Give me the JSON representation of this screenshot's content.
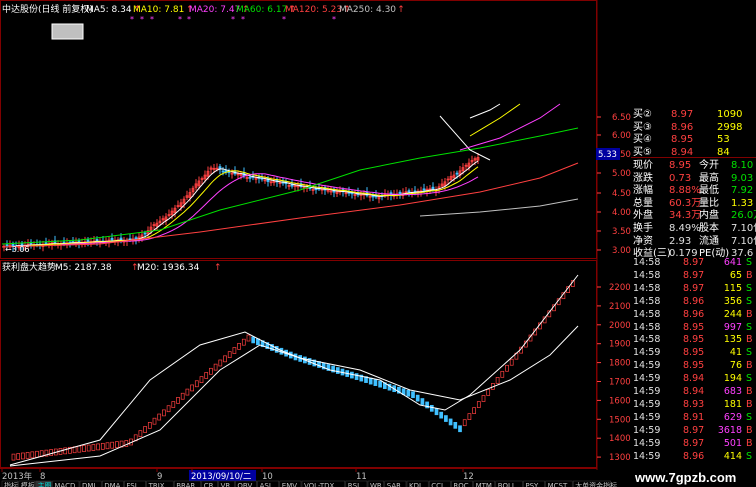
{
  "header": {
    "stock_name": "中达股份(日线 前复权)",
    "ma_items": [
      {
        "label": "MA5: 8.34",
        "color": "#ffffff"
      },
      {
        "label": "MA10: 7.81",
        "color": "#ffff00"
      },
      {
        "label": "MA20: 7.47",
        "color": "#ff40ff"
      },
      {
        "label": "MA60: 6.17",
        "color": "#00e000"
      },
      {
        "label": "MA120: 5.23",
        "color": "#ff4040"
      },
      {
        "label": "MA250: 4.30",
        "color": "#c0c0c0"
      }
    ]
  },
  "main_chart": {
    "price_axis": [
      "6.50",
      "6.00",
      "5.50",
      "5.00",
      "4.50",
      "4.00",
      "3.50",
      "3.00"
    ],
    "current_price_tag": "5.33",
    "low_annotation": "←3.06"
  },
  "sub_chart": {
    "title": "获利盘大趋势",
    "m5": "M5: 2187.38",
    "m20": "M20: 1936.34",
    "axis": [
      "2200",
      "2100",
      "2000",
      "1900",
      "1800",
      "1700",
      "1600",
      "1500",
      "1400",
      "1300"
    ]
  },
  "x_axis": {
    "labels": [
      "2013年",
      "8",
      "9",
      "2013/09/10/二",
      "10",
      "11",
      "12"
    ]
  },
  "bottom_tabs": [
    "指标",
    "模板",
    "主图",
    "MACD",
    "DMI",
    "DMA",
    "FSL",
    "TRIX",
    "BRAR",
    "CR",
    "VR",
    "OBV",
    "ASI",
    "EMV",
    "VOL-TDX",
    "RSI",
    "WR",
    "SAR",
    "KDJ",
    "CCI",
    "ROC",
    "MTM",
    "BOLL",
    "PSY",
    "MCST",
    "大单资金指标"
  ],
  "quote_panel": {
    "order_book": [
      {
        "label": "买②",
        "price": "8.97",
        "vol": "1090"
      },
      {
        "label": "买③",
        "price": "8.96",
        "vol": "2998"
      },
      {
        "label": "买④",
        "price": "8.95",
        "vol": "53"
      },
      {
        "label": "买⑤",
        "price": "8.94",
        "vol": "84"
      }
    ],
    "stats": [
      {
        "l1": "现价",
        "v1": "8.95",
        "l2": "今开",
        "v2": "8.10"
      },
      {
        "l1": "涨跌",
        "v1": "0.73",
        "l2": "最高",
        "v2": "9.03"
      },
      {
        "l1": "涨幅",
        "v1": "8.88%",
        "l2": "最低",
        "v2": "7.92"
      },
      {
        "l1": "总量",
        "v1": "60.3万",
        "l2": "量比",
        "v2": "1.33"
      },
      {
        "l1": "外盘",
        "v1": "34.3万",
        "l2": "内盘",
        "v2": "26.0万"
      },
      {
        "l1": "换手",
        "v1": "8.49%",
        "l2": "股本",
        "v2": "7.10亿"
      },
      {
        "l1": "净资",
        "v1": "2.93",
        "l2": "流通",
        "v2": "7.10亿"
      },
      {
        "l1": "收益(三)",
        "v1": "0.179",
        "l2": "PE(动)",
        "v2": "37.6"
      }
    ]
  },
  "ticks": [
    {
      "time": "14:58",
      "price": "8.97",
      "vol": "641",
      "side": "S"
    },
    {
      "time": "14:58",
      "price": "8.97",
      "vol": "65",
      "side": "B"
    },
    {
      "time": "14:58",
      "price": "8.97",
      "vol": "115",
      "side": "S"
    },
    {
      "time": "14:58",
      "price": "8.96",
      "vol": "356",
      "side": "S"
    },
    {
      "time": "14:58",
      "price": "8.96",
      "vol": "244",
      "side": "B"
    },
    {
      "time": "14:58",
      "price": "8.95",
      "vol": "997",
      "side": "S"
    },
    {
      "time": "14:58",
      "price": "8.95",
      "vol": "135",
      "side": "B"
    },
    {
      "time": "14:59",
      "price": "8.95",
      "vol": "41",
      "side": "S"
    },
    {
      "time": "14:59",
      "price": "8.95",
      "vol": "76",
      "side": "B"
    },
    {
      "time": "14:59",
      "price": "8.94",
      "vol": "194",
      "side": "S"
    },
    {
      "time": "14:59",
      "price": "8.94",
      "vol": "683",
      "side": "B"
    },
    {
      "time": "14:59",
      "price": "8.93",
      "vol": "181",
      "side": "B"
    },
    {
      "time": "14:59",
      "price": "8.91",
      "vol": "629",
      "side": "S"
    },
    {
      "time": "14:59",
      "price": "8.97",
      "vol": "3618",
      "side": "B"
    },
    {
      "time": "14:59",
      "price": "8.97",
      "vol": "501",
      "side": "B"
    },
    {
      "time": "14:59",
      "price": "8.96",
      "vol": "414",
      "side": "S"
    }
  ],
  "watermark": "www.7gpzb.com",
  "colors": {
    "up": "#ff4040",
    "down": "#40c0ff",
    "ma5": "#ffffff",
    "ma10": "#ffff00",
    "ma20": "#ff40ff",
    "ma60": "#00e000",
    "ma120": "#ff4040",
    "ma250": "#c0c0c0",
    "grid": "#800000"
  }
}
